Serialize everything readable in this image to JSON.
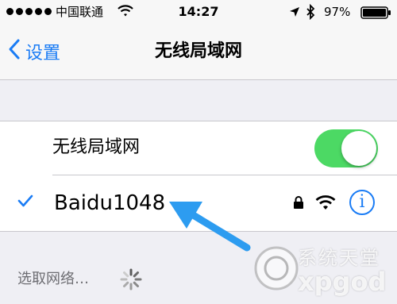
{
  "status_bar": {
    "carrier": "中国联通",
    "time": "14:27",
    "battery_percent": "97%"
  },
  "nav": {
    "back_label": "设置",
    "title": "无线局域网"
  },
  "wifi_toggle": {
    "label": "无线局域网",
    "on": true
  },
  "connected_network": {
    "name": "Baidu1048",
    "info_label": "i"
  },
  "networks_section": {
    "label": "选取网络…"
  },
  "watermark": {
    "top_text": "系统天堂",
    "bottom_text": "xpgod"
  },
  "colors": {
    "accent": "#1a7cf5",
    "toggle_on": "#4cd964",
    "arrow": "#2d9cf0"
  },
  "icons": [
    "wifi-icon",
    "location-icon",
    "bluetooth-icon",
    "battery-icon",
    "chevron-left-icon",
    "checkmark-icon",
    "lock-icon",
    "info-icon",
    "spinner-icon"
  ]
}
